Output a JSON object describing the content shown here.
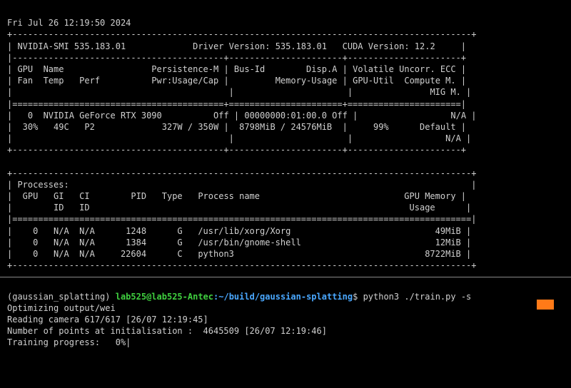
{
  "timestamp": "Fri Jul 26 12:19:50 2024",
  "divider_top": "+-----------------------------------------------------------------------------------------+",
  "smi_header": {
    "left": "NVIDIA-SMI 535.183.01",
    "mid": "Driver Version: 535.183.01",
    "right": "CUDA Version: 12.2"
  },
  "divider_three": "|-----------------------------------------+----------------------+----------------------+",
  "cols": {
    "r1": {
      "a": "GPU  Name                 Persistence-M",
      "b": "Bus-Id        Disp.A",
      "c": "Volatile Uncorr. ECC"
    },
    "r2": {
      "a": "Fan  Temp   Perf          Pwr:Usage/Cap",
      "b": "        Memory-Usage",
      "c": "GPU-Util  Compute M."
    },
    "r3": {
      "a": "                                       ",
      "b": "                    ",
      "c": "              MIG M."
    }
  },
  "divider_eq3": "|=========================================+======================+======================|",
  "gpu": {
    "r1": {
      "a": "  0  NVIDIA GeForce RTX 3090          Off",
      "b": "00000000:01:00.0 Off",
      "c": "                 N/A"
    },
    "r2": {
      "a": " 30%   49C   P2             327W / 350W ",
      "b": " 8798MiB / 24576MiB ",
      "c": "    99%      Default"
    },
    "r3": {
      "a": "                                       ",
      "b": "                    ",
      "c": "                 N/A"
    }
  },
  "divider_bot3": "+-----------------------------------------+----------------------+----------------------+",
  "blank": "                                                                                           ",
  "divider_full": "+-----------------------------------------------------------------------------------------+",
  "proc_title": "Processes:",
  "proc_cols": {
    "r1": " GPU   GI   CI        PID   Type   Process name                            GPU Memory ",
    "r2": "       ID   ID                                                              Usage      "
  },
  "divider_eqfull": "|=========================================================================================|",
  "procs": [
    "   0   N/A  N/A      1248      G   /usr/lib/xorg/Xorg                            49MiB ",
    "   0   N/A  N/A      1384      G   /usr/bin/gnome-shell                          12MiB ",
    "   0   N/A  N/A     22604      C   python3                                     8722MiB "
  ],
  "prompt": {
    "env": "(gaussian_splatting)",
    "user": "lab525@lab525-Antec",
    "sep": ":",
    "path": "~/build/gaussian-splatting",
    "dollar": "$",
    "cmd": "python3 ./train.py -s"
  },
  "output": [
    "Optimizing output/wei",
    "Reading camera 617/617 [26/07 12:19:45]",
    "Number of points at initialisation :  4645509 [26/07 12:19:46]",
    "Training progress:   0%|"
  ]
}
